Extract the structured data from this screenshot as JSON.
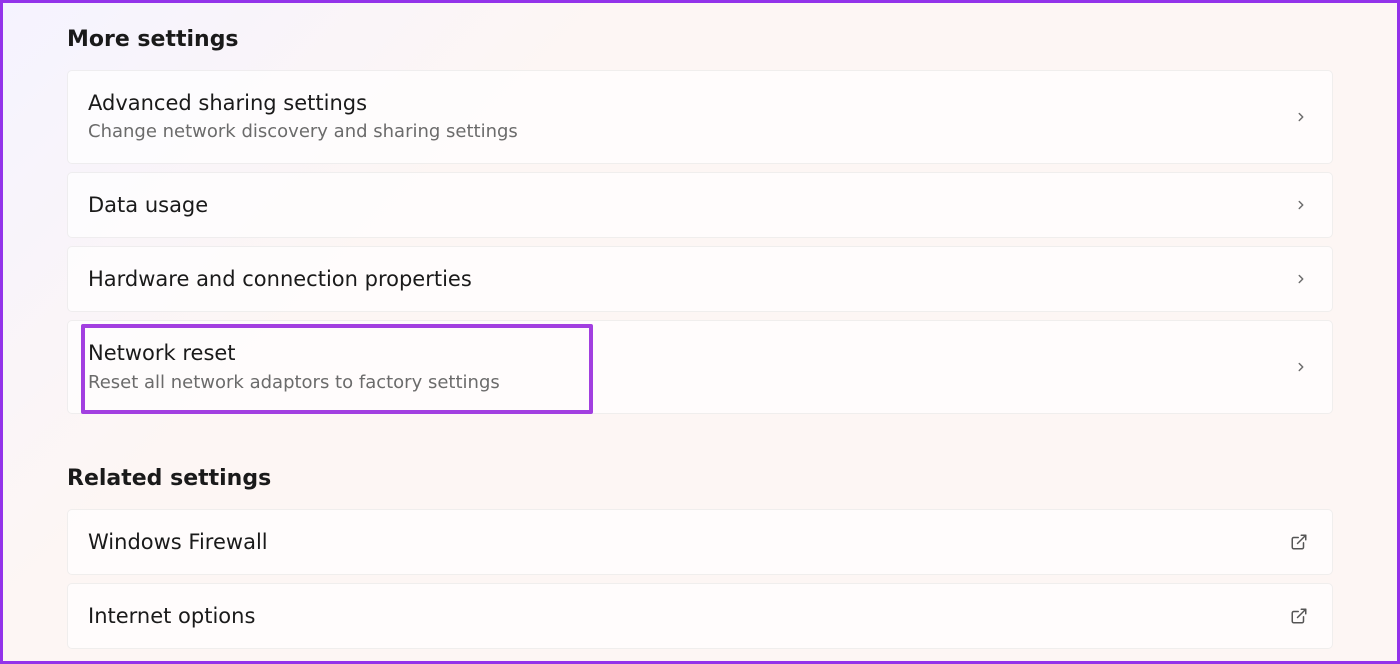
{
  "sections": {
    "more_settings": {
      "heading": "More settings",
      "items": [
        {
          "title": "Advanced sharing settings",
          "subtitle": "Change network discovery and sharing settings",
          "icon": "chevron"
        },
        {
          "title": "Data usage",
          "subtitle": "",
          "icon": "chevron"
        },
        {
          "title": "Hardware and connection properties",
          "subtitle": "",
          "icon": "chevron"
        },
        {
          "title": "Network reset",
          "subtitle": "Reset all network adaptors to factory settings",
          "icon": "chevron",
          "highlighted": true
        }
      ]
    },
    "related_settings": {
      "heading": "Related settings",
      "items": [
        {
          "title": "Windows Firewall",
          "subtitle": "",
          "icon": "external"
        },
        {
          "title": "Internet options",
          "subtitle": "",
          "icon": "external"
        }
      ]
    }
  }
}
